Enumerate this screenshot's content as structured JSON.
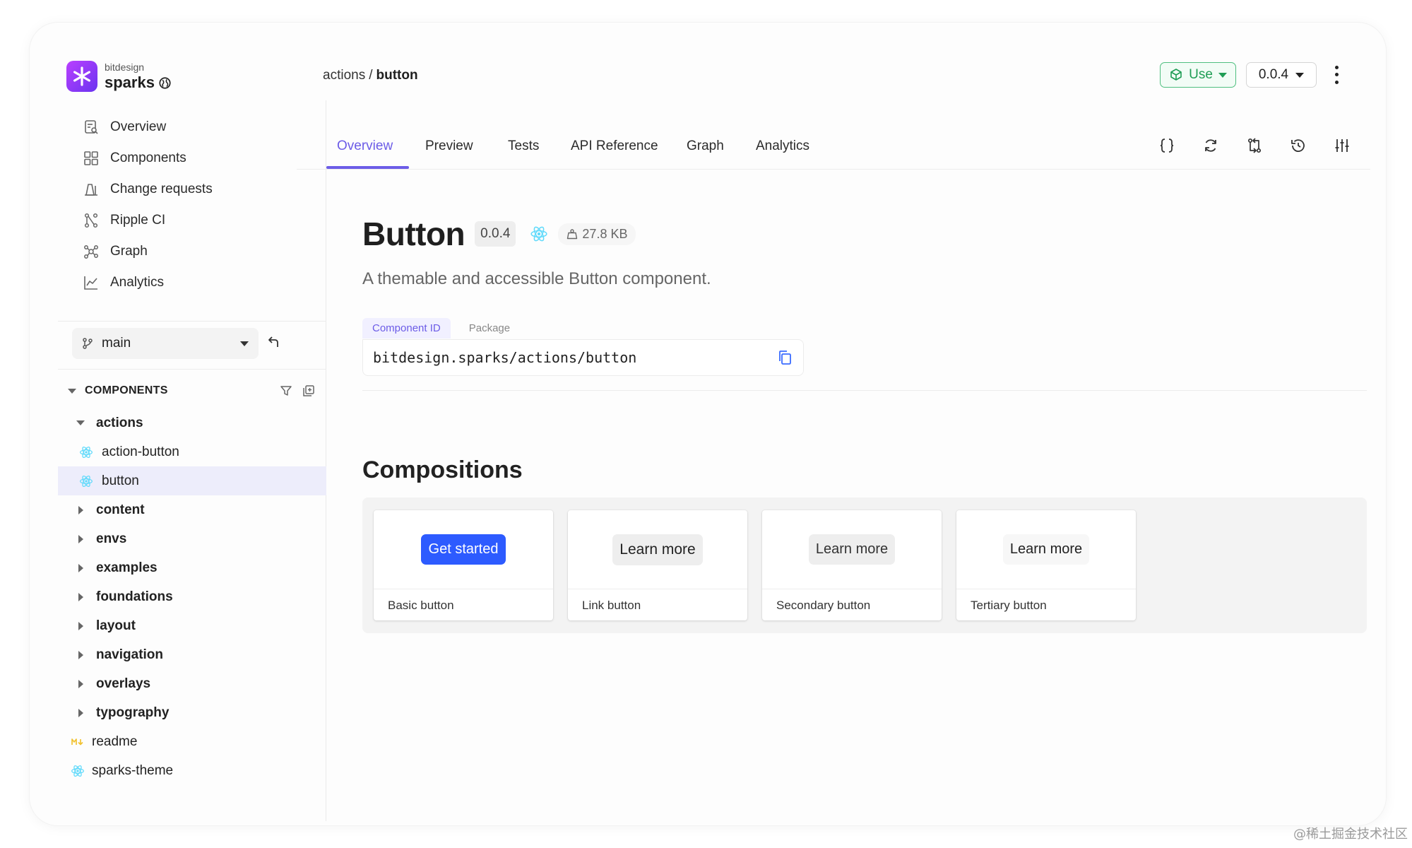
{
  "brand": {
    "org": "bitdesign",
    "scope": "sparks"
  },
  "breadcrumb": {
    "parent": "actions",
    "separator": "/",
    "current": "button"
  },
  "header": {
    "use_label": "Use",
    "version": "0.0.4"
  },
  "sidebar": {
    "nav": [
      {
        "label": "Overview",
        "icon": "overview-icon"
      },
      {
        "label": "Components",
        "icon": "components-grid-icon"
      },
      {
        "label": "Change requests",
        "icon": "change-requests-icon"
      },
      {
        "label": "Ripple CI",
        "icon": "ripple-ci-icon"
      },
      {
        "label": "Graph",
        "icon": "graph-icon"
      },
      {
        "label": "Analytics",
        "icon": "analytics-icon"
      }
    ],
    "branch": "main",
    "components_heading": "COMPONENTS",
    "tree": [
      {
        "label": "actions",
        "type": "folder",
        "expanded": true
      },
      {
        "label": "action-button",
        "type": "component"
      },
      {
        "label": "button",
        "type": "component",
        "selected": true
      },
      {
        "label": "content",
        "type": "folder"
      },
      {
        "label": "envs",
        "type": "folder"
      },
      {
        "label": "examples",
        "type": "folder"
      },
      {
        "label": "foundations",
        "type": "folder"
      },
      {
        "label": "layout",
        "type": "folder"
      },
      {
        "label": "navigation",
        "type": "folder"
      },
      {
        "label": "overlays",
        "type": "folder"
      },
      {
        "label": "typography",
        "type": "folder"
      },
      {
        "label": "readme",
        "type": "readme"
      },
      {
        "label": "sparks-theme",
        "type": "component"
      }
    ]
  },
  "tabs": [
    "Overview",
    "Preview",
    "Tests",
    "API Reference",
    "Graph",
    "Analytics"
  ],
  "active_tab": "Overview",
  "component": {
    "name": "Button",
    "version": "0.0.4",
    "size": "27.8 KB",
    "description": "A themable and accessible Button component.",
    "id_tabs": [
      "Component ID",
      "Package"
    ],
    "id": "bitdesign.sparks/actions/button"
  },
  "compositions": {
    "title": "Compositions",
    "cards": [
      {
        "button": "Get started",
        "label": "Basic button",
        "style": "primary"
      },
      {
        "button": "Learn more",
        "label": "Link button",
        "style": "link"
      },
      {
        "button": "Learn more",
        "label": "Secondary button",
        "style": "secondary"
      },
      {
        "button": "Learn more",
        "label": "Tertiary button",
        "style": "tertiary"
      }
    ]
  },
  "colors": {
    "accent": "#6c5ce7",
    "use_green": "#1f9d55",
    "primary_button": "#2d5bff",
    "selected_row": "#ededfb"
  },
  "watermark": "@稀土掘金技术社区"
}
